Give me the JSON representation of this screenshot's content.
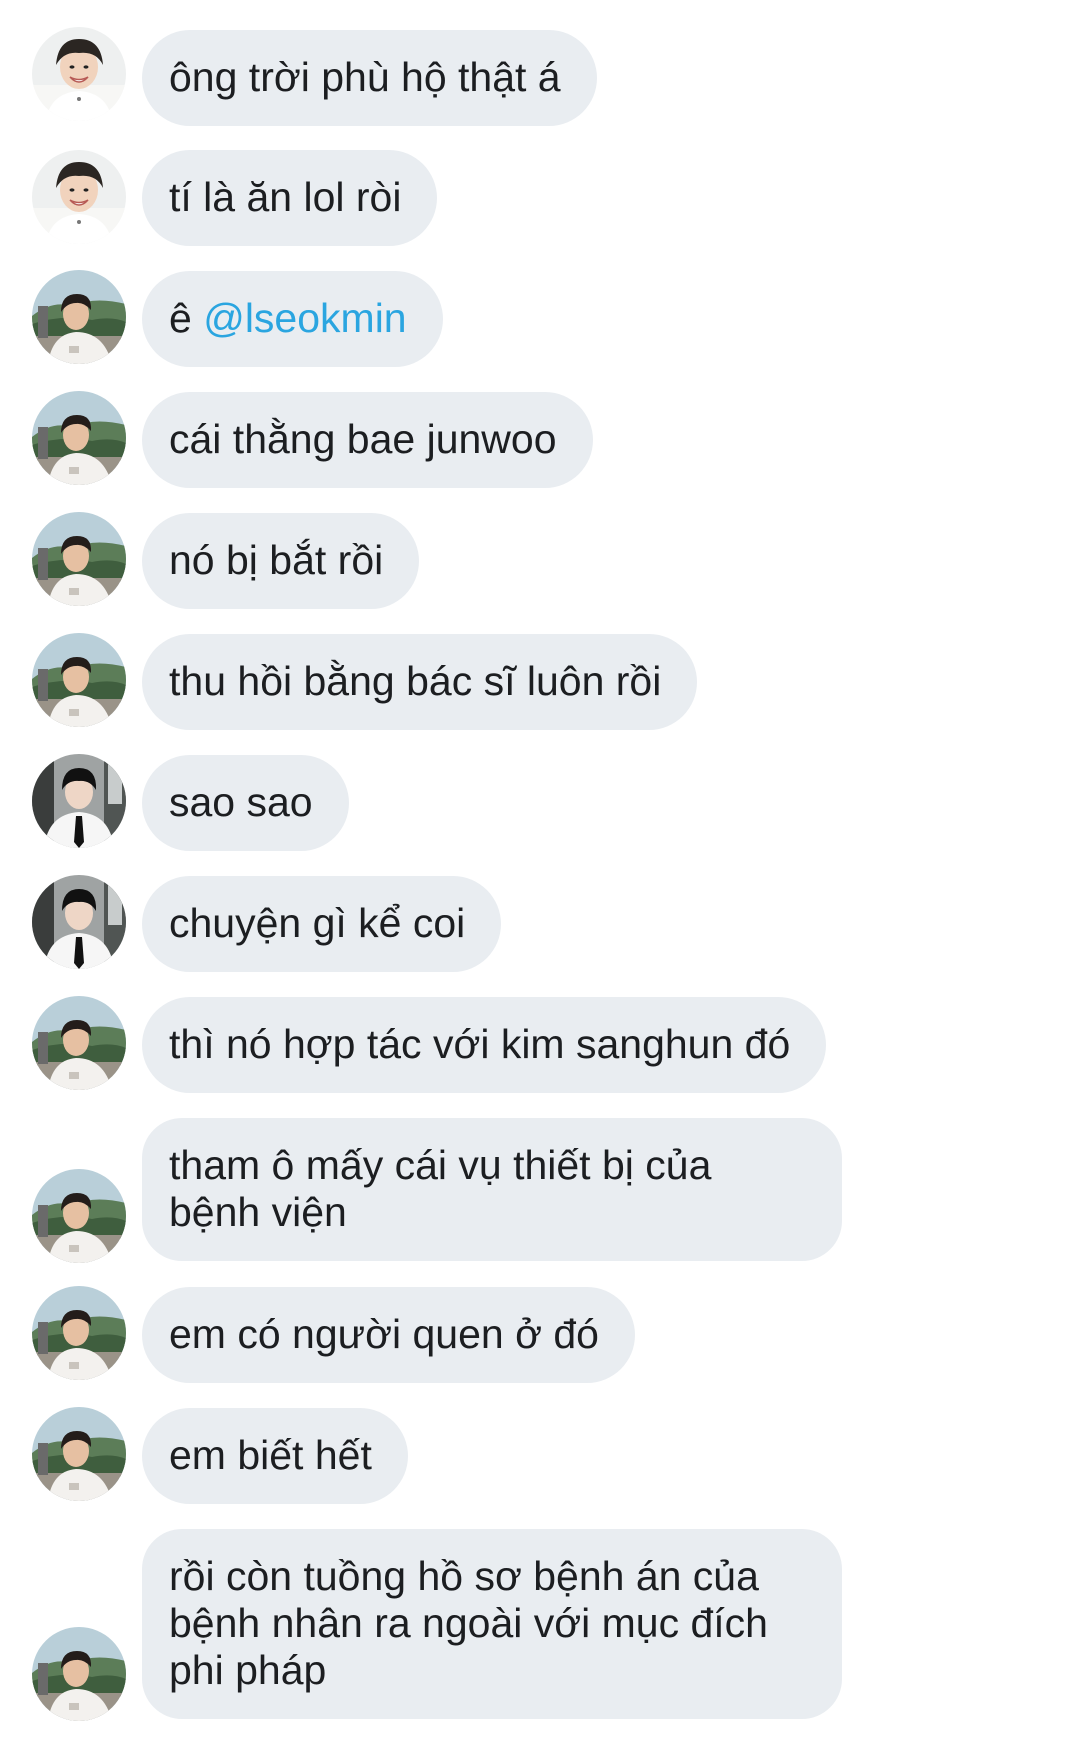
{
  "conversation": {
    "messages": [
      {
        "sender": "user-a",
        "avatar": "avatar-user-a",
        "text": "ông trời phù hộ thật á"
      },
      {
        "sender": "user-a",
        "avatar": "avatar-user-a",
        "text": "tí là ăn lol ròi"
      },
      {
        "sender": "user-b",
        "avatar": "avatar-user-b",
        "prefix": "ê ",
        "mention": "@lseokmin"
      },
      {
        "sender": "user-b",
        "avatar": "avatar-user-b",
        "text": "cái thằng bae junwoo"
      },
      {
        "sender": "user-b",
        "avatar": "avatar-user-b",
        "text": "nó bị bắt rồi"
      },
      {
        "sender": "user-b",
        "avatar": "avatar-user-b",
        "text": "thu hồi bằng bác sĩ luôn rồi"
      },
      {
        "sender": "user-c",
        "avatar": "avatar-user-c",
        "text": "sao sao"
      },
      {
        "sender": "user-c",
        "avatar": "avatar-user-c",
        "text": "chuyện gì kể coi"
      },
      {
        "sender": "user-b",
        "avatar": "avatar-user-b",
        "text": "thì nó hợp tác với kim sanghun đó"
      },
      {
        "sender": "user-b",
        "avatar": "avatar-user-b",
        "text": "tham ô mấy cái vụ thiết bị của bệnh viện"
      },
      {
        "sender": "user-b",
        "avatar": "avatar-user-b",
        "text": "em có người quen ở đó"
      },
      {
        "sender": "user-b",
        "avatar": "avatar-user-b",
        "text": "em biết hết"
      },
      {
        "sender": "user-b",
        "avatar": "avatar-user-b",
        "text": "rồi còn tuồng hồ sơ bệnh án của bệnh nhân ra ngoài với mục đích phi pháp"
      }
    ]
  },
  "colors": {
    "bubble": "#e9edf1",
    "text": "#1c1e21",
    "mention": "#2aa5e0"
  }
}
